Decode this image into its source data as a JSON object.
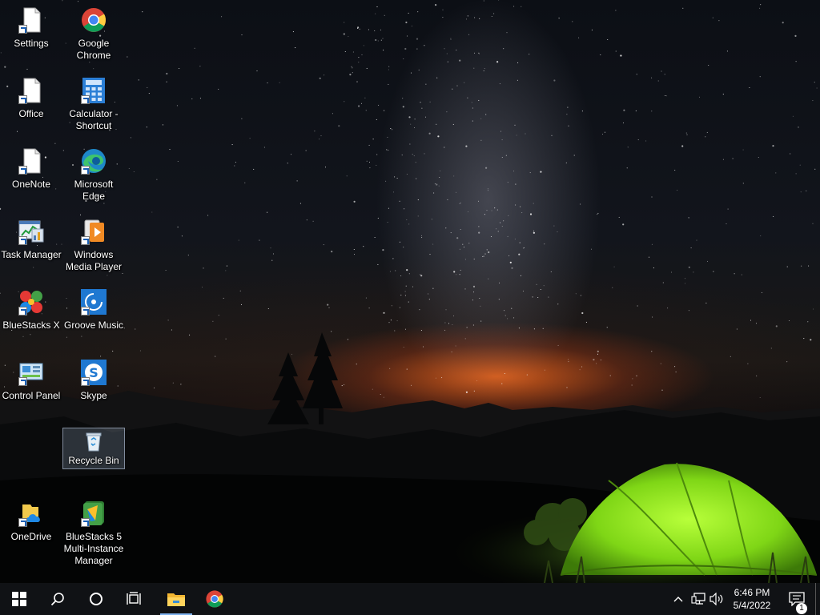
{
  "desktop": {
    "icons": [
      {
        "label": "Settings",
        "icon": "settings-file-icon"
      },
      {
        "label": "Google Chrome",
        "icon": "chrome-icon"
      },
      {
        "label": "Office",
        "icon": "office-file-icon"
      },
      {
        "label": "Calculator - Shortcut",
        "icon": "calculator-icon"
      },
      {
        "label": "OneNote",
        "icon": "onenote-file-icon"
      },
      {
        "label": "Microsoft Edge",
        "icon": "edge-icon"
      },
      {
        "label": "Task Manager",
        "icon": "task-manager-icon"
      },
      {
        "label": "Windows Media Player",
        "icon": "media-player-icon"
      },
      {
        "label": "BlueStacks X",
        "icon": "bluestacks-x-icon"
      },
      {
        "label": "Groove Music",
        "icon": "groove-music-icon"
      },
      {
        "label": "Control Panel",
        "icon": "control-panel-icon"
      },
      {
        "label": "Skype",
        "icon": "skype-icon"
      },
      {
        "label": "Recycle Bin",
        "icon": "recycle-bin-icon",
        "selected": true
      },
      {
        "label": "OneDrive",
        "icon": "onedrive-icon"
      },
      {
        "label": "BlueStacks 5 Multi-Instance Manager",
        "icon": "bluestacks-multi-instance-icon"
      }
    ]
  },
  "taskbar": {
    "start": "windows-start-icon",
    "search": "search-icon",
    "cortana": "cortana-circle-icon",
    "task_view": "task-view-icon",
    "pinned": [
      {
        "app": "File Explorer",
        "icon": "file-explorer-icon",
        "active": true
      },
      {
        "app": "Google Chrome",
        "icon": "chrome-icon",
        "active": false
      }
    ],
    "tray": {
      "chevron": "chevron-up-icon",
      "network": "network-icon",
      "volume": "volume-icon",
      "time": "6:46 PM",
      "date": "5/4/2022",
      "notifications": "notification-icon",
      "notification_count": "1"
    }
  },
  "colors": {
    "taskbar": "#101215",
    "accent": "#7fb3f0",
    "tent": "#8ee01a",
    "horizon_glow": "#de601c"
  }
}
